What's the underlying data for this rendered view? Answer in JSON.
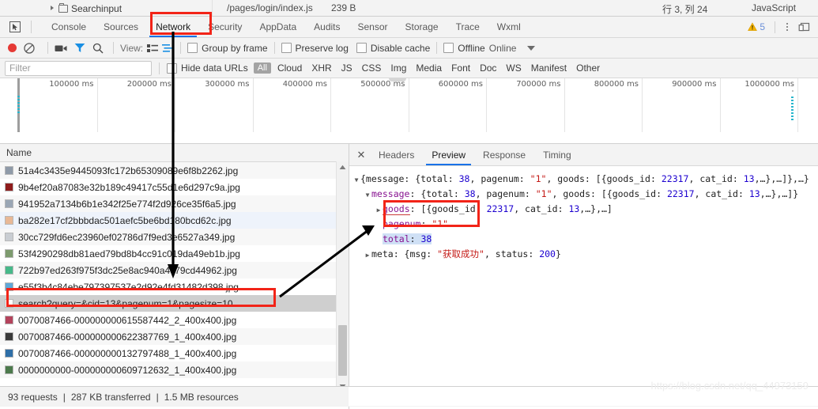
{
  "editor_strip": {
    "tree_label": "Searchinput",
    "path": "/pages/login/index.js",
    "size": "239 B",
    "cursor_pos": "行 3, 列 24",
    "language": "JavaScript"
  },
  "tabbar": {
    "inspect_icon": "inspect-cursor-icon",
    "tabs": [
      {
        "label": "Console",
        "active": false
      },
      {
        "label": "Sources",
        "active": false
      },
      {
        "label": "Network",
        "active": true
      },
      {
        "label": "Security",
        "active": false
      },
      {
        "label": "AppData",
        "active": false
      },
      {
        "label": "Audits",
        "active": false
      },
      {
        "label": "Sensor",
        "active": false
      },
      {
        "label": "Storage",
        "active": false
      },
      {
        "label": "Trace",
        "active": false
      },
      {
        "label": "Wxml",
        "active": false
      }
    ],
    "warning_count": "5",
    "warning_icon": "warning-triangle-icon",
    "kebab_icon": "more-options-icon",
    "dock_icon": "dock-position-icon"
  },
  "toolbar": {
    "record_icon": "record-dot-icon",
    "clear_icon": "clear-no-entry-icon",
    "camera_icon": "capture-screenshots-icon",
    "funnel_icon": "filter-funnel-icon",
    "search_icon": "search-icon",
    "view_label": "View:",
    "view_list_icon": "view-list-icon",
    "view_waterfall_icon": "view-waterfall-icon",
    "group_by_frame": "Group by frame",
    "preserve_log": "Preserve log",
    "disable_cache": "Disable cache",
    "offline": "Offline",
    "online": "Online",
    "throttle_caret_icon": "chevron-down-icon"
  },
  "filterbar": {
    "filter_value": "",
    "filter_placeholder": "Filter",
    "hide_data_urls": "Hide data URLs",
    "types": [
      "All",
      "Cloud",
      "XHR",
      "JS",
      "CSS",
      "Img",
      "Media",
      "Font",
      "Doc",
      "WS",
      "Manifest",
      "Other"
    ],
    "active_type": "All"
  },
  "overview": {
    "ticks": [
      "100000 ms",
      "200000 ms",
      "300000 ms",
      "400000 ms",
      "500000 ms",
      "600000 ms",
      "700000 ms",
      "800000 ms",
      "900000 ms",
      "1000000 ms"
    ]
  },
  "requests": {
    "column_header": "Name",
    "rows": [
      {
        "name": "51a4c3435e9445093fc172b65309089e6f8b2262.jpg",
        "thumb": "#8f9aa8",
        "band": "odd",
        "selected": false
      },
      {
        "name": "9b4ef20a87083e32b189c49417c55d1e6d297c9a.jpg",
        "thumb": "#8e1c1c",
        "band": "even",
        "selected": false
      },
      {
        "name": "941952a7134b6b1e342f25e774f2d926ce35f6a5.jpg",
        "thumb": "#9aa6b4",
        "band": "odd",
        "selected": false
      },
      {
        "name": "ba282e17cf2bbbdac501aefc5be6bd180bcd62c.jpg",
        "thumb": "#e8b896",
        "band": "blue",
        "selected": false
      },
      {
        "name": "30cc729fd6ec23960ef02786d7f9ed3e6527a349.jpg",
        "thumb": "#c9cdd2",
        "band": "odd",
        "selected": false
      },
      {
        "name": "53f4290298db81aed79bd8b4cc91c019da49eb1b.jpg",
        "thumb": "#7d9b6e",
        "band": "even",
        "selected": false
      },
      {
        "name": "722b97ed263f975f3dc25e8ac940a4c79cd44962.jpg",
        "thumb": "#47b98a",
        "band": "odd",
        "selected": false
      },
      {
        "name": "e55f3b4c84ebe797397537e2d92e4fd31482d398.jpg",
        "thumb": "#5fa8d8",
        "band": "even",
        "selected": false
      },
      {
        "name": "search?query=&cid=13&pagenum=1&pagesize=10",
        "thumb": "#ffffff",
        "band": "selected",
        "selected": true
      },
      {
        "name": "0070087466-000000000615587442_2_400x400.jpg",
        "thumb": "#b4435c",
        "band": "even",
        "selected": false
      },
      {
        "name": "0070087466-000000000622387769_1_400x400.jpg",
        "thumb": "#3a3a3a",
        "band": "odd",
        "selected": false
      },
      {
        "name": "0070087466-000000000132797488_1_400x400.jpg",
        "thumb": "#2f6fa8",
        "band": "even",
        "selected": false
      },
      {
        "name": "0000000000-000000000609712632_1_400x400.jpg",
        "thumb": "#4c7a4c",
        "band": "odd",
        "selected": false
      }
    ],
    "scroll_up_icon": "scroll-up-arrow-icon",
    "scroll_down_icon": "scroll-down-arrow-icon"
  },
  "details": {
    "close_icon": "close-icon",
    "tabs": [
      {
        "label": "Headers",
        "active": false
      },
      {
        "label": "Preview",
        "active": true
      },
      {
        "label": "Response",
        "active": false
      },
      {
        "label": "Timing",
        "active": false
      }
    ],
    "preview_lines": [
      {
        "indent": 0,
        "triangle": "down",
        "segments": [
          {
            "text": "{message: {total: ",
            "cls": "plain"
          },
          {
            "text": "38",
            "cls": "num"
          },
          {
            "text": ", pagenum: ",
            "cls": "plain"
          },
          {
            "text": "\"1\"",
            "cls": "str"
          },
          {
            "text": ", goods: [{goods_id: ",
            "cls": "plain"
          },
          {
            "text": "22317",
            "cls": "num"
          },
          {
            "text": ", cat_id: ",
            "cls": "plain"
          },
          {
            "text": "13",
            "cls": "num"
          },
          {
            "text": ",…},…]},…}",
            "cls": "plain"
          }
        ]
      },
      {
        "indent": 1,
        "triangle": "down",
        "segments": [
          {
            "text": "message",
            "cls": "key"
          },
          {
            "text": ": {total: ",
            "cls": "plain"
          },
          {
            "text": "38",
            "cls": "num"
          },
          {
            "text": ", pagenum: ",
            "cls": "plain"
          },
          {
            "text": "\"1\"",
            "cls": "str"
          },
          {
            "text": ", goods: [{goods_id: ",
            "cls": "plain"
          },
          {
            "text": "22317",
            "cls": "num"
          },
          {
            "text": ", cat_id: ",
            "cls": "plain"
          },
          {
            "text": "13",
            "cls": "num"
          },
          {
            "text": ",…},…]}",
            "cls": "plain"
          }
        ]
      },
      {
        "indent": 2,
        "triangle": "right",
        "segments": [
          {
            "text": "goods",
            "cls": "key-under"
          },
          {
            "text": ": [{goods_id: ",
            "cls": "plain"
          },
          {
            "text": "22317",
            "cls": "num"
          },
          {
            "text": ", cat_id: ",
            "cls": "plain"
          },
          {
            "text": "13",
            "cls": "num"
          },
          {
            "text": ",…},…]",
            "cls": "plain"
          }
        ]
      },
      {
        "indent": 2,
        "triangle": "none",
        "segments": [
          {
            "text": "pagenum",
            "cls": "key"
          },
          {
            "text": ": ",
            "cls": "plain"
          },
          {
            "text": "\"1\"",
            "cls": "str"
          }
        ]
      },
      {
        "indent": 2,
        "triangle": "none",
        "highlight": true,
        "segments": [
          {
            "text": "total",
            "cls": "key"
          },
          {
            "text": ": ",
            "cls": "plain"
          },
          {
            "text": "38",
            "cls": "num"
          }
        ]
      },
      {
        "indent": 1,
        "triangle": "right",
        "segments": [
          {
            "text": "meta",
            "cls": "plain"
          },
          {
            "text": ": {msg: ",
            "cls": "plain"
          },
          {
            "text": "\"获取成功\"",
            "cls": "str"
          },
          {
            "text": ", status: ",
            "cls": "plain"
          },
          {
            "text": "200",
            "cls": "num"
          },
          {
            "text": "}",
            "cls": "plain"
          }
        ]
      }
    ]
  },
  "statusbar": {
    "requests": "93 requests",
    "transferred": "287 KB transferred",
    "resources": "1.5 MB resources"
  },
  "watermark": "https://blog.csdn.net/qq_44973159",
  "annotations": {
    "highlight_color": "#f22418",
    "boxes": [
      "network-tab",
      "selected-request-row",
      "pagenum-total-fields"
    ],
    "arrows": [
      "toolbar-to-request-arrow",
      "request-to-preview-arrow"
    ]
  }
}
